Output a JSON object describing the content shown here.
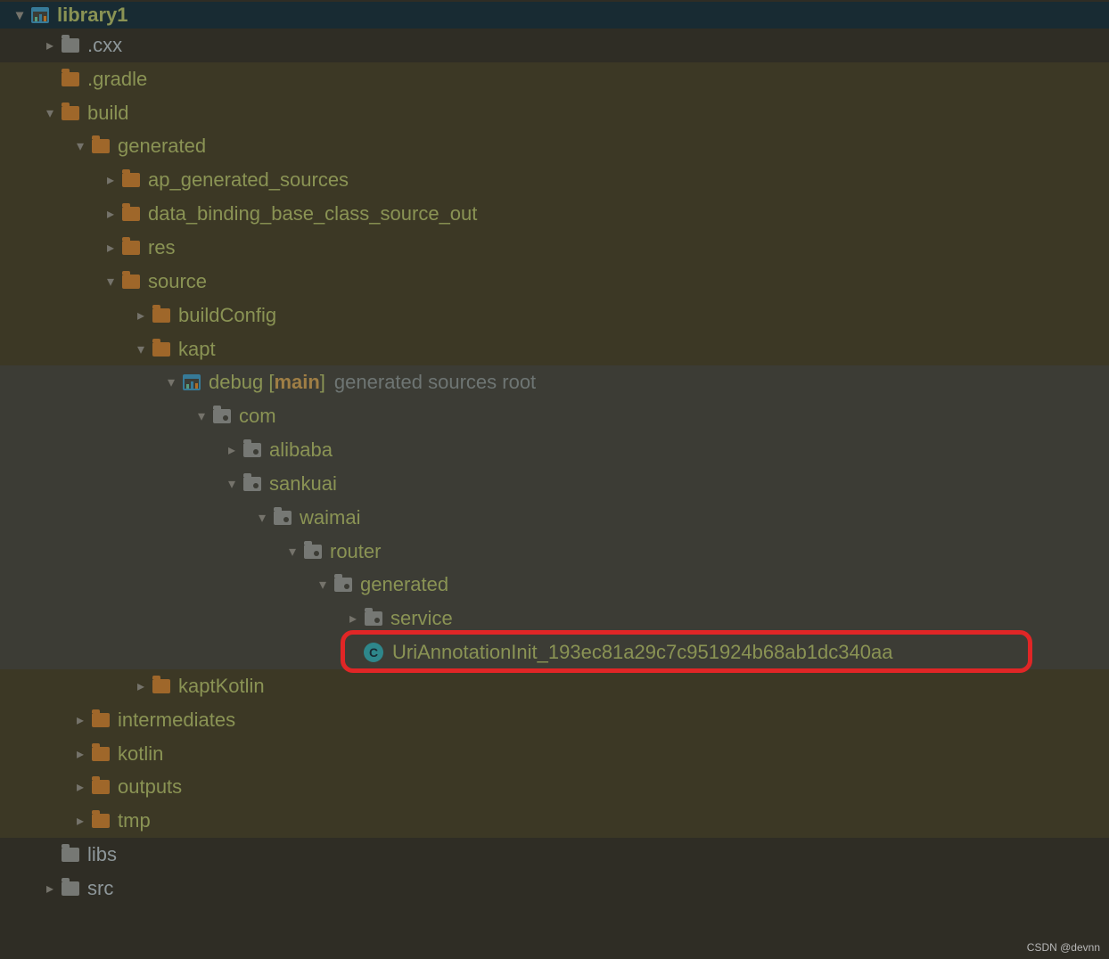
{
  "watermark": "CSDN @devnn",
  "tree": [
    {
      "depth": 0,
      "arrow": "down",
      "icon": "module",
      "style": "top",
      "label": "library1"
    },
    {
      "depth": 1,
      "arrow": "right",
      "icon": "folder-grey",
      "style": "plain",
      "label": ".cxx"
    },
    {
      "depth": 1,
      "arrow": "none",
      "icon": "folder-orange",
      "style": "build",
      "label": ".gradle"
    },
    {
      "depth": 1,
      "arrow": "down",
      "icon": "folder-orange",
      "style": "build",
      "label": "build"
    },
    {
      "depth": 2,
      "arrow": "down",
      "icon": "folder-orange",
      "style": "build",
      "label": "generated"
    },
    {
      "depth": 3,
      "arrow": "right",
      "icon": "folder-orange",
      "style": "build",
      "label": "ap_generated_sources"
    },
    {
      "depth": 3,
      "arrow": "right",
      "icon": "folder-orange",
      "style": "build",
      "label": "data_binding_base_class_source_out"
    },
    {
      "depth": 3,
      "arrow": "right",
      "icon": "folder-orange",
      "style": "build",
      "label": "res"
    },
    {
      "depth": 3,
      "arrow": "down",
      "icon": "folder-orange",
      "style": "build",
      "label": "source"
    },
    {
      "depth": 4,
      "arrow": "right",
      "icon": "folder-orange",
      "style": "build",
      "label": "buildConfig"
    },
    {
      "depth": 4,
      "arrow": "down",
      "icon": "folder-orange",
      "style": "build",
      "label": "kapt"
    },
    {
      "depth": 5,
      "arrow": "down",
      "icon": "module",
      "style": "source",
      "label": "debug",
      "labelBoldPart": "main",
      "suffix": "generated sources root"
    },
    {
      "depth": 6,
      "arrow": "down",
      "icon": "package",
      "style": "source",
      "label": "com"
    },
    {
      "depth": 7,
      "arrow": "right",
      "icon": "package",
      "style": "source",
      "label": "alibaba"
    },
    {
      "depth": 7,
      "arrow": "down",
      "icon": "package",
      "style": "source",
      "label": "sankuai"
    },
    {
      "depth": 8,
      "arrow": "down",
      "icon": "package",
      "style": "source",
      "label": "waimai"
    },
    {
      "depth": 9,
      "arrow": "down",
      "icon": "package",
      "style": "source",
      "label": "router"
    },
    {
      "depth": 10,
      "arrow": "down",
      "icon": "package",
      "style": "source",
      "label": "generated"
    },
    {
      "depth": 11,
      "arrow": "right",
      "icon": "package",
      "style": "source",
      "label": "service"
    },
    {
      "depth": 11,
      "arrow": "none",
      "icon": "class",
      "style": "source",
      "label": "UriAnnotationInit_193ec81a29c7c951924b68ab1dc340aa",
      "highlight": true
    },
    {
      "depth": 4,
      "arrow": "right",
      "icon": "folder-orange",
      "style": "build",
      "label": "kaptKotlin"
    },
    {
      "depth": 2,
      "arrow": "right",
      "icon": "folder-orange",
      "style": "build",
      "label": "intermediates"
    },
    {
      "depth": 2,
      "arrow": "right",
      "icon": "folder-orange",
      "style": "build",
      "label": "kotlin"
    },
    {
      "depth": 2,
      "arrow": "right",
      "icon": "folder-orange",
      "style": "build",
      "label": "outputs"
    },
    {
      "depth": 2,
      "arrow": "right",
      "icon": "folder-orange",
      "style": "build",
      "label": "tmp"
    },
    {
      "depth": 1,
      "arrow": "none",
      "icon": "folder-grey",
      "style": "plain",
      "label": "libs"
    },
    {
      "depth": 1,
      "arrow": "right",
      "icon": "folder-grey",
      "style": "plain",
      "label": "src"
    }
  ]
}
